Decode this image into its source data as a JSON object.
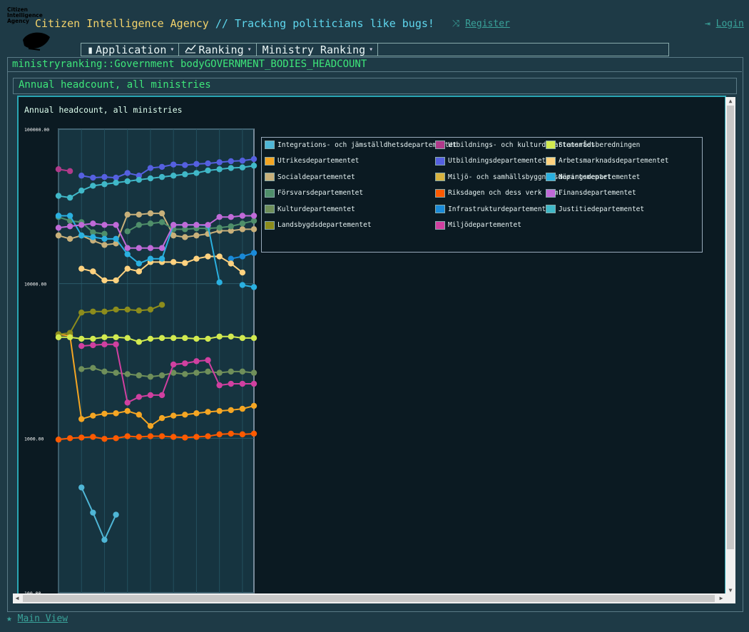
{
  "header": {
    "logo_text": "Citizen Intelligence Agency",
    "brand_name": "Citizen Intelligence Agency",
    "brand_tagline": "// Tracking politicians like bugs!",
    "register_label": "Register",
    "login_label": "Login"
  },
  "menu": [
    {
      "label": "Application",
      "icon": "bottle-icon"
    },
    {
      "label": "Ranking",
      "icon": "line-chart-icon"
    },
    {
      "label": "Ministry Ranking",
      "icon": ""
    }
  ],
  "page_title": "ministryranking::Government bodyGOVERNMENT_BODIES_HEADCOUNT",
  "panel_title": "Annual headcount, all ministries",
  "footer": {
    "main_view_label": "Main View"
  },
  "chart_data": {
    "type": "line",
    "title": "Annual headcount, all ministries",
    "y_scale": "log",
    "ylim": [
      100,
      100000
    ],
    "y_ticks": [
      "100000.00",
      "10000.00",
      "1000.00",
      "100.00"
    ],
    "grid": true,
    "legend_placement": "right",
    "x": [
      0,
      1,
      2,
      3,
      4,
      5,
      6,
      7,
      8,
      9,
      10,
      11,
      12,
      13,
      14,
      15,
      16,
      17
    ],
    "series": [
      {
        "name": "Integrations- och jämställdhetsdepartementet",
        "color": "#4fb6d6",
        "values": [
          null,
          null,
          480,
          330,
          220,
          320,
          null,
          null,
          null,
          null,
          null,
          null,
          null,
          null,
          null,
          null,
          null,
          null
        ]
      },
      {
        "name": "Utrikesdepartementet",
        "color": "#f5a623",
        "values": [
          4700,
          4600,
          1330,
          1400,
          1440,
          1450,
          1500,
          1420,
          1200,
          1350,
          1400,
          1420,
          1450,
          1480,
          1500,
          1520,
          1550,
          1620
        ]
      },
      {
        "name": "Socialdepartementet",
        "color": "#c8b07a",
        "values": [
          20500,
          19500,
          20500,
          19000,
          17800,
          18200,
          28000,
          28000,
          28500,
          28500,
          20500,
          20000,
          20500,
          21000,
          22000,
          22000,
          22500,
          22500
        ]
      },
      {
        "name": "Försvarsdepartementet",
        "color": "#4f8f6a",
        "values": [
          27000,
          25500,
          25000,
          21500,
          21000,
          null,
          21800,
          24000,
          24500,
          25000,
          22500,
          22500,
          22800,
          22800,
          23000,
          23500,
          24500,
          25500
        ]
      },
      {
        "name": "Kulturdepartementet",
        "color": "#6f8f5a",
        "values": [
          null,
          null,
          2800,
          2850,
          2700,
          2650,
          2600,
          2550,
          2500,
          2550,
          2650,
          2600,
          2650,
          2700,
          2650,
          2700,
          2700,
          2650
        ]
      },
      {
        "name": "Landsbygdsdepartementet",
        "color": "#8c8c1c",
        "values": [
          4700,
          4800,
          6500,
          6600,
          6600,
          6800,
          6800,
          6700,
          6800,
          7300,
          null,
          null,
          null,
          null,
          null,
          null,
          null,
          null
        ]
      },
      {
        "name": "Utbildnings- och kulturdepartementet",
        "color": "#b03a8a",
        "values": [
          55000,
          53500,
          null,
          null,
          null,
          null,
          null,
          null,
          null,
          null,
          null,
          null,
          null,
          null,
          null,
          null,
          null,
          null
        ]
      },
      {
        "name": "Utbildningsdepartementet",
        "color": "#5560e0",
        "values": [
          null,
          null,
          50000,
          48500,
          49000,
          48500,
          52000,
          50000,
          56000,
          57000,
          59000,
          58500,
          59500,
          60000,
          61000,
          62000,
          62500,
          64000
        ]
      },
      {
        "name": "Miljö- och samhällsbyggnadsdepartementet",
        "color": "#d8b340",
        "values": [
          null,
          null,
          null,
          null,
          null,
          null,
          null,
          null,
          null,
          null,
          null,
          null,
          null,
          null,
          null,
          null,
          null,
          null
        ]
      },
      {
        "name": "Riksdagen och dess verk m.m.",
        "color": "#ff5a00",
        "values": [
          980,
          1000,
          1010,
          1020,
          990,
          1000,
          1030,
          1020,
          1030,
          1030,
          1020,
          1010,
          1020,
          1030,
          1060,
          1070,
          1060,
          1070
        ]
      },
      {
        "name": "Infrastrukturdepartementet",
        "color": "#1a8ad8",
        "values": [
          null,
          null,
          null,
          null,
          null,
          null,
          null,
          null,
          null,
          null,
          null,
          null,
          null,
          null,
          null,
          14500,
          15000,
          15800
        ]
      },
      {
        "name": "Miljödepartementet",
        "color": "#d040a0",
        "values": [
          null,
          null,
          3950,
          4000,
          4050,
          4050,
          1700,
          1850,
          1900,
          1900,
          3000,
          3050,
          3150,
          3200,
          2200,
          2250,
          2250,
          2250
        ]
      },
      {
        "name": "Statsrådsberedningen",
        "color": "#d2ea50",
        "values": [
          4500,
          4500,
          4400,
          4400,
          4500,
          4500,
          4450,
          4200,
          4400,
          4450,
          4450,
          4450,
          4400,
          4400,
          4550,
          4550,
          4450,
          4450
        ]
      },
      {
        "name": "Arbetsmarknadsdepartementet",
        "color": "#ffd27f",
        "values": [
          null,
          null,
          12500,
          12000,
          10500,
          10500,
          12500,
          12000,
          13800,
          13800,
          13800,
          13600,
          14500,
          15000,
          15000,
          13500,
          11800,
          null
        ]
      },
      {
        "name": "Näringsdepartementet",
        "color": "#2ab0e0",
        "values": [
          27500,
          27500,
          20500,
          20000,
          19500,
          19500,
          15500,
          13500,
          14500,
          14500,
          24000,
          24000,
          24000,
          23800,
          10200,
          null,
          9800,
          9500
        ]
      },
      {
        "name": "Finansdepartementet",
        "color": "#c06ad8",
        "values": [
          23000,
          23500,
          24000,
          24500,
          24000,
          24000,
          17000,
          17000,
          17000,
          17000,
          24000,
          24000,
          24000,
          24000,
          27000,
          27000,
          27500,
          27500
        ]
      },
      {
        "name": "Justitiedepartementet",
        "color": "#40b8c8",
        "values": [
          37000,
          36000,
          40000,
          43000,
          44000,
          45000,
          46000,
          47000,
          48000,
          49000,
          50000,
          51000,
          52000,
          54000,
          55000,
          56000,
          56500,
          58000
        ]
      }
    ]
  }
}
